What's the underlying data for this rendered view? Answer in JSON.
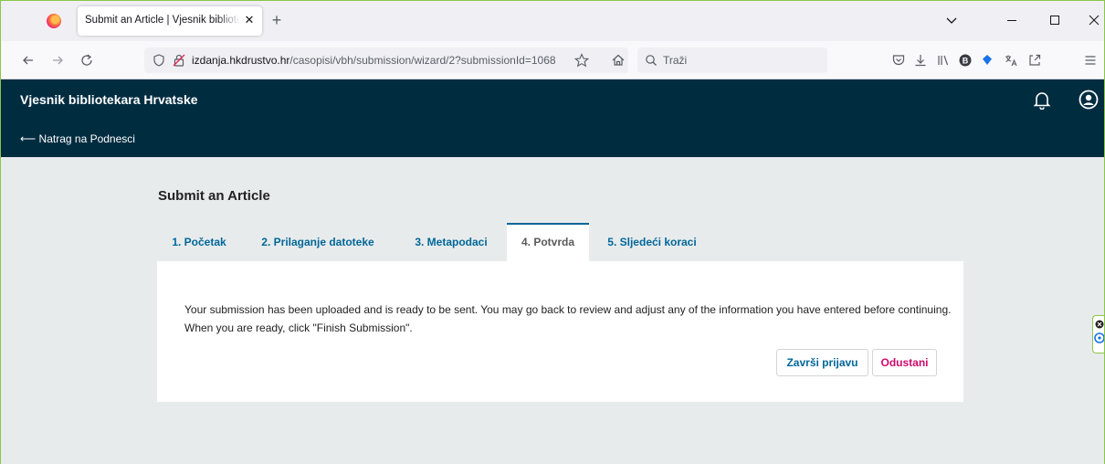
{
  "browser": {
    "tab_title": "Submit an Article | Vjesnik bibliotekara Hrvatske",
    "tab_close": "✕",
    "new_tab": "+",
    "url_host": "izdanja.hkdrustvo.hr",
    "url_path": "/casopisi/vbh/submission/wizard/2?submissionId=1068",
    "search_placeholder": "Traži",
    "icons": [
      "firefox-logo-icon",
      "back-icon",
      "forward-icon",
      "reload-icon",
      "shield-icon",
      "lock-icon",
      "star-icon",
      "home-icon",
      "search-icon",
      "pocket-icon",
      "download-icon",
      "library-icon",
      "extension-b-icon",
      "bitwarden-icon",
      "translate-icon",
      "share-icon",
      "menu-icon"
    ]
  },
  "header": {
    "site_title": "Vjesnik bibliotekara Hrvatske",
    "back_link": "⟵ Natrag na Podnesci"
  },
  "main": {
    "page_title": "Submit an Article",
    "tabs": [
      {
        "label": "1. Početak"
      },
      {
        "label": "2. Prilaganje datoteke"
      },
      {
        "label": "3. Metapodaci"
      },
      {
        "label": "4. Potvrda"
      },
      {
        "label": "5. Sljedeći koraci"
      }
    ],
    "active_tab": "4. Potvrda",
    "message": "Your submission has been uploaded and is ready to be sent. You may go back to review and adjust any of the information you have entered before continuing. When you are ready, click \"Finish Submission\".",
    "finish_button": "Završi prijavu",
    "cancel_button": "Odustani"
  },
  "colors": {
    "header_bg": "#002c40",
    "link_blue": "#006798",
    "cancel_pink": "#d00a6c",
    "page_bg": "#e8ebec"
  }
}
